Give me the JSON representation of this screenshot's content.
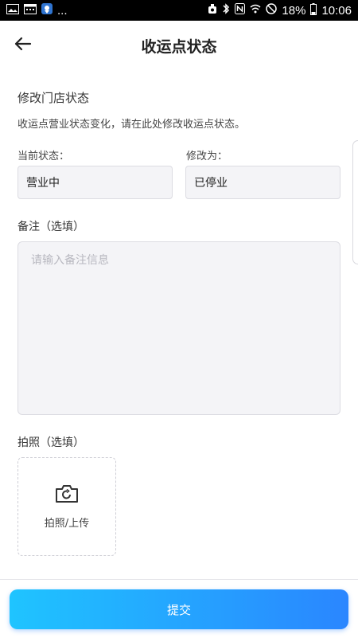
{
  "status_bar": {
    "battery_percent": "18%",
    "time": "10:06",
    "ellipsis": "..."
  },
  "header": {
    "title": "收运点状态"
  },
  "section": {
    "title": "修改门店状态",
    "description": "收运点营业状态变化，请在此处修改收运点状态。"
  },
  "state": {
    "current_label": "当前状态：",
    "current_value": "营业中",
    "modify_label": "修改为：",
    "modify_value": "已停业"
  },
  "remark": {
    "label": "备注（选填）",
    "placeholder": "请输入备注信息"
  },
  "photo": {
    "label": "拍照（选填）",
    "upload_label": "拍照/上传"
  },
  "submit": {
    "label": "提交"
  },
  "colors": {
    "primary_gradient_start": "#1fc4ff",
    "primary_gradient_end": "#2a86ff",
    "field_background": "#f4f4f7"
  }
}
